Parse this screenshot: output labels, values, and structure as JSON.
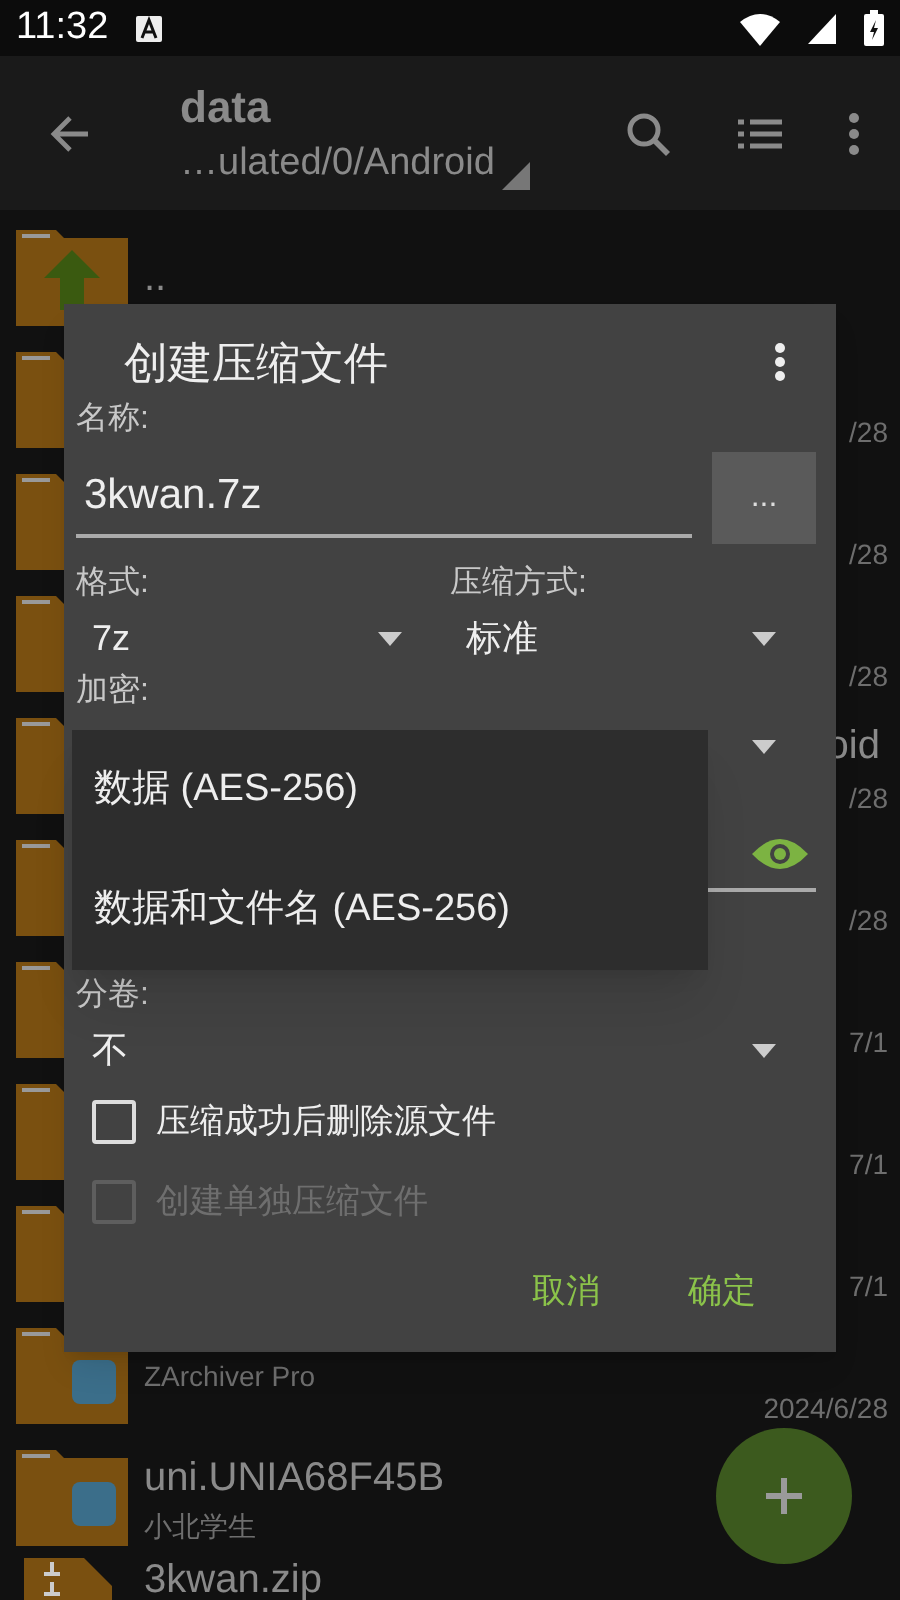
{
  "status_bar": {
    "time": "11:32"
  },
  "app_bar": {
    "title": "data",
    "path": "…ulated/0/Android"
  },
  "files": [
    {
      "kind": "up",
      "name": ".."
    },
    {
      "kind": "folder",
      "date": "/28"
    },
    {
      "kind": "folder",
      "date": "/28"
    },
    {
      "kind": "folder",
      "date": "/28"
    },
    {
      "kind": "folder",
      "name_tail": "oid",
      "date": "/28"
    },
    {
      "kind": "folder",
      "date": "/28"
    },
    {
      "kind": "folder",
      "date": "7/1"
    },
    {
      "kind": "folder",
      "date": "7/1"
    },
    {
      "kind": "folder",
      "date": "7/1"
    },
    {
      "kind": "app_folder",
      "subtitle": "ZArchiver Pro",
      "date": "2024/6/28"
    },
    {
      "kind": "app_folder",
      "name": "uni.UNIA68F45B",
      "subtitle": "小北学生"
    },
    {
      "kind": "archive",
      "name": "3kwan.zip"
    }
  ],
  "dialog": {
    "title": "创建压缩文件",
    "name_label": "名称:",
    "name_value": "3kwan.7z",
    "browse_button": "...",
    "format": {
      "label": "格式:",
      "value": "7z"
    },
    "method": {
      "label": "压缩方式:",
      "value": "标准"
    },
    "encryption": {
      "label": "加密:"
    },
    "split": {
      "label": "分卷:",
      "value": "不"
    },
    "checkboxes": [
      {
        "label": "压缩成功后删除源文件",
        "checked": false,
        "disabled": false
      },
      {
        "label": "创建单独压缩文件",
        "checked": false,
        "disabled": true
      }
    ],
    "buttons": [
      "取消",
      "确定"
    ],
    "encryption_menu": [
      {
        "label": "数据 (AES-256)"
      },
      {
        "label": "数据和文件名 (AES-256)"
      }
    ]
  }
}
